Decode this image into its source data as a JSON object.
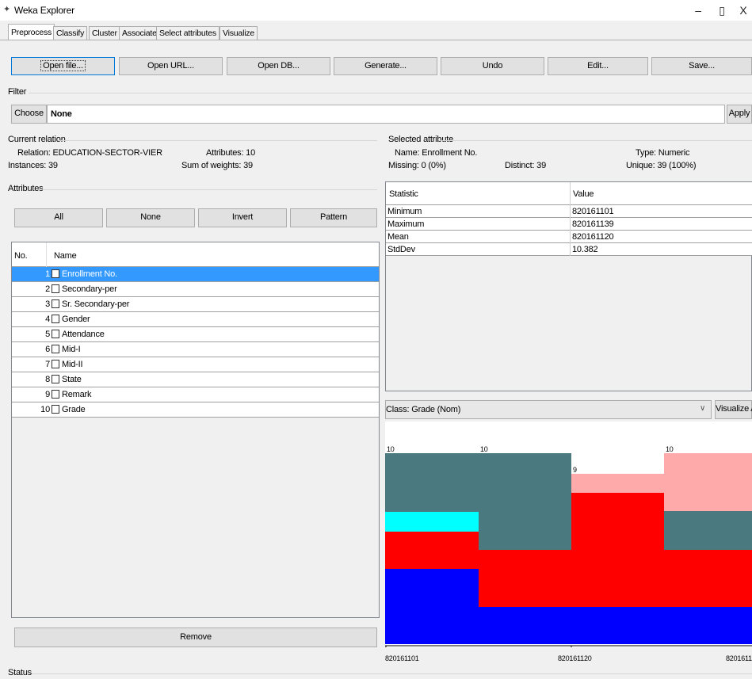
{
  "window": {
    "title": "Weka Explorer",
    "minimize": "–",
    "restore": "▯",
    "close": "X"
  },
  "tabs": [
    "Preprocess",
    "Classify",
    "Cluster",
    "Associate",
    "Select attributes",
    "Visualize"
  ],
  "toolbar": [
    "Open file...",
    "Open URL...",
    "Open DB...",
    "Generate...",
    "Undo",
    "Edit...",
    "Save..."
  ],
  "filter": {
    "label": "Filter",
    "choose": "Choose",
    "value": "None",
    "apply": "Apply"
  },
  "current_relation": {
    "label": "Current relation",
    "relation": "Relation: EDUCATION-SECTOR-VIER",
    "instances": "Instances: 39",
    "attributes": "Attributes: 10",
    "sum_weights": "Sum of weights: 39"
  },
  "attributes": {
    "label": "Attributes",
    "buttons": [
      "All",
      "None",
      "Invert",
      "Pattern"
    ],
    "col_no": "No.",
    "col_name": "Name",
    "rows": [
      {
        "no": "1",
        "name": "Enrollment No."
      },
      {
        "no": "2",
        "name": "Secondary-per"
      },
      {
        "no": "3",
        "name": "Sr. Secondary-per"
      },
      {
        "no": "4",
        "name": "Gender"
      },
      {
        "no": "5",
        "name": "Attendance"
      },
      {
        "no": "6",
        "name": "Mid-I"
      },
      {
        "no": "7",
        "name": "Mid-II"
      },
      {
        "no": "8",
        "name": "State"
      },
      {
        "no": "9",
        "name": "Remark"
      },
      {
        "no": "10",
        "name": "Grade"
      }
    ],
    "remove": "Remove"
  },
  "selected_attribute": {
    "label": "Selected attribute",
    "name": "Name: Enrollment No.",
    "type": "Type: Numeric",
    "missing": "Missing: 0 (0%)",
    "distinct": "Distinct: 39",
    "unique": "Unique: 39 (100%)",
    "col_stat": "Statistic",
    "col_value": "Value",
    "stats": [
      {
        "s": "Minimum",
        "v": "820161101"
      },
      {
        "s": "Maximum",
        "v": "820161139"
      },
      {
        "s": "Mean",
        "v": "820161120"
      },
      {
        "s": "StdDev",
        "v": "10.382"
      }
    ]
  },
  "class_select": {
    "value": "Class: Grade (Nom)",
    "visualize_all": "Visualize All"
  },
  "histogram": {
    "bin_counts": [
      "10",
      "10",
      "9",
      "10"
    ],
    "axis_labels": [
      "820161101",
      "820161120",
      "8201611"
    ],
    "colors": {
      "blue": "#0000ff",
      "red": "#ff0000",
      "cyan": "#00ffff",
      "teal": "#4a7a80",
      "pink": "#ffaaaa"
    }
  },
  "status": {
    "label": "Status"
  }
}
